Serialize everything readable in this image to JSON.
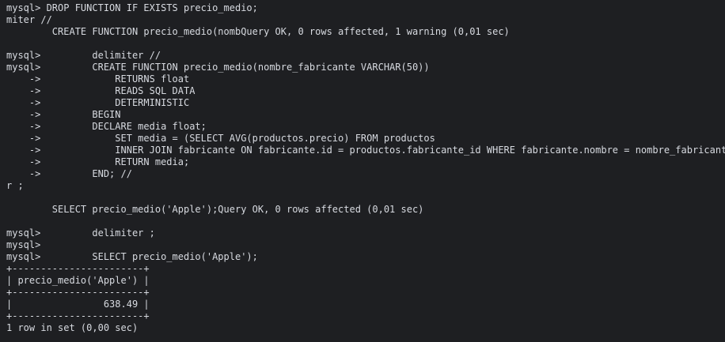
{
  "terminal": {
    "lines": [
      "mysql> DROP FUNCTION IF EXISTS precio_medio;",
      "miter //",
      "        CREATE FUNCTION precio_medio(nombQuery OK, 0 rows affected, 1 warning (0,01 sec)",
      "",
      "mysql>         delimiter //",
      "mysql>         CREATE FUNCTION precio_medio(nombre_fabricante VARCHAR(50))",
      "    ->             RETURNS float",
      "    ->             READS SQL DATA",
      "    ->             DETERMINISTIC",
      "    ->         BEGIN",
      "    ->         DECLARE media float;",
      "    ->             SET media = (SELECT AVG(productos.precio) FROM productos",
      "    ->             INNER JOIN fabricante ON fabricante.id = productos.fabricante_id WHERE fabricante.nombre = nombre_fabricante);",
      "    ->             RETURN media;",
      "    ->         END; //",
      "r ;",
      "",
      "        SELECT precio_medio('Apple');Query OK, 0 rows affected (0,01 sec)",
      "",
      "mysql>         delimiter ;",
      "mysql>",
      "mysql>         SELECT precio_medio('Apple');",
      "+-----------------------+",
      "| precio_medio('Apple') |",
      "+-----------------------+",
      "|                638.49 |",
      "+-----------------------+",
      "1 row in set (0,00 sec)"
    ]
  }
}
